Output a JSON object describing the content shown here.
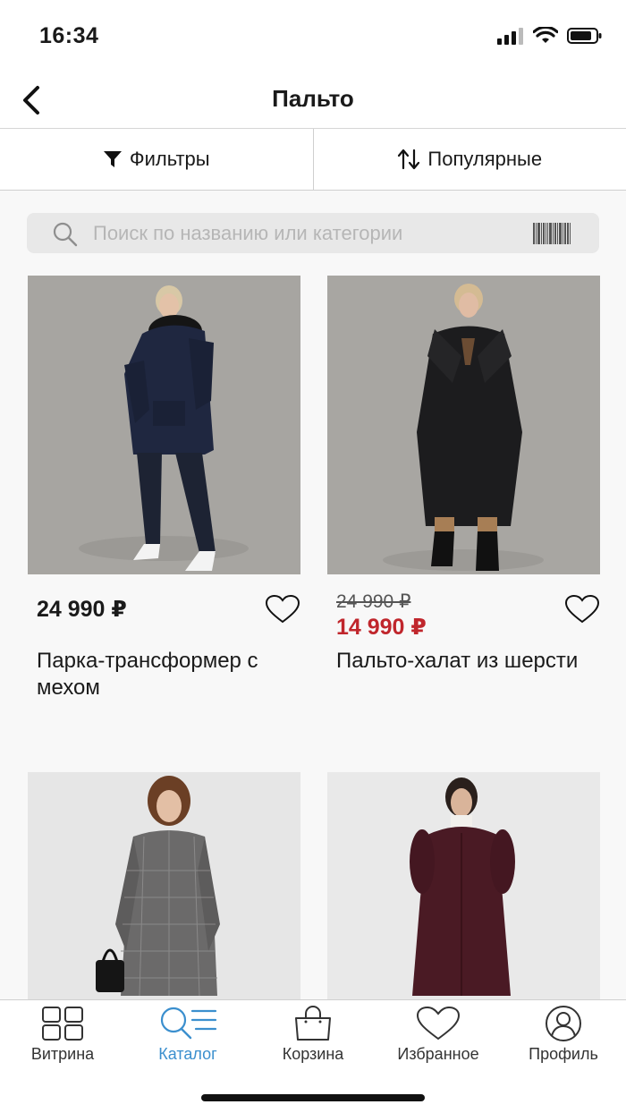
{
  "status": {
    "time": "16:34"
  },
  "nav": {
    "title": "Пальто"
  },
  "filters": {
    "filter_label": "Фильтры",
    "sort_label": "Популярные"
  },
  "search": {
    "placeholder": "Поиск по названию или категории"
  },
  "products": [
    {
      "price": "24 990 ₽",
      "name": "Парка-трансформер с мехом",
      "coat_color": "#1f2740",
      "photo_bg": "#a7a5a1"
    },
    {
      "old_price": "24 990 ₽",
      "sale_price": "14 990 ₽",
      "name": "Пальто-халат из шерсти",
      "coat_color": "#1c1c1e",
      "photo_bg": "#a8a6a2"
    },
    {
      "name": "",
      "coat_color": "#6b6a6a",
      "photo_bg": "#e6e6e6"
    },
    {
      "name": "",
      "coat_color": "#4a1a24",
      "photo_bg": "#e9e9e9"
    }
  ],
  "tabs": [
    {
      "label": "Витрина",
      "icon": "grid-icon",
      "active": false
    },
    {
      "label": "Каталог",
      "icon": "catalog-search-icon",
      "active": true
    },
    {
      "label": "Корзина",
      "icon": "bag-icon",
      "active": false
    },
    {
      "label": "Избранное",
      "icon": "heart-icon",
      "active": false
    },
    {
      "label": "Профиль",
      "icon": "profile-icon",
      "active": false
    }
  ],
  "colors": {
    "accent": "#3b8fce",
    "sale": "#c0262c",
    "text": "#1a1a1a"
  }
}
